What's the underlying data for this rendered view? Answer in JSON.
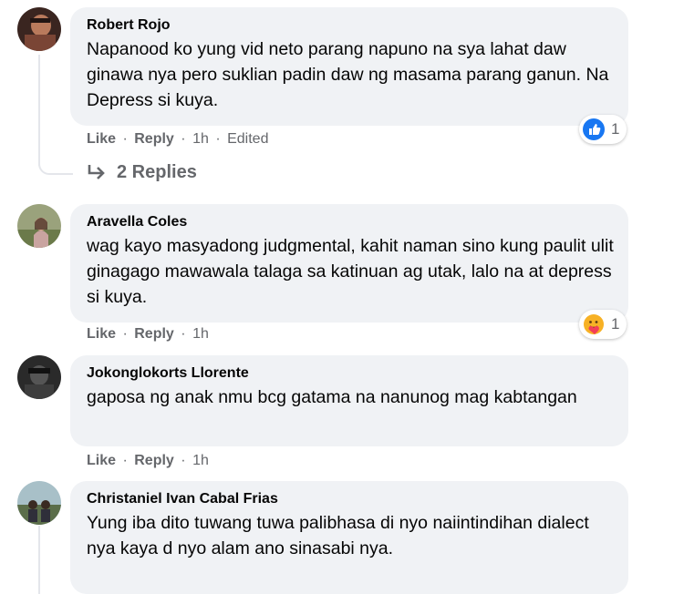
{
  "comments": [
    {
      "author": "Robert Rojo",
      "text": "Napanood ko yung vid neto parang napuno na sya lahat daw ginawa nya pero suklian padin daw ng masama parang ganun. Na Depress si kuya.",
      "like_label": "Like",
      "reply_label": "Reply",
      "time": "1h",
      "edited": "Edited",
      "reaction": {
        "icon": "like-icon",
        "count": "1"
      },
      "replies_label": "2 Replies"
    },
    {
      "author": "Aravella Coles",
      "text": "wag kayo masyadong judgmental, kahit naman sino kung paulit ulit ginagago mawawala talaga sa katinuan ag utak, lalo na at depress si kuya.",
      "like_label": "Like",
      "reply_label": "Reply",
      "time": "1h",
      "reaction": {
        "icon": "care-icon",
        "count": "1"
      }
    },
    {
      "author": "Jokonglokorts Llorente",
      "text": "gaposa ng anak nmu bcg gatama na nanunog mag kabtangan",
      "like_label": "Like",
      "reply_label": "Reply",
      "time": "1h"
    },
    {
      "author": "Christaniel Ivan Cabal Frias",
      "text": "Yung iba dito tuwang tuwa palibhasa di nyo naiintindihan dialect nya kaya d nyo alam ano sinasabi nya."
    }
  ],
  "separator": "·",
  "colors": {
    "bubble": "#f0f2f5",
    "meta": "#65676b",
    "like_blue": "#1877f2",
    "care_yellow": "#f7b125"
  }
}
